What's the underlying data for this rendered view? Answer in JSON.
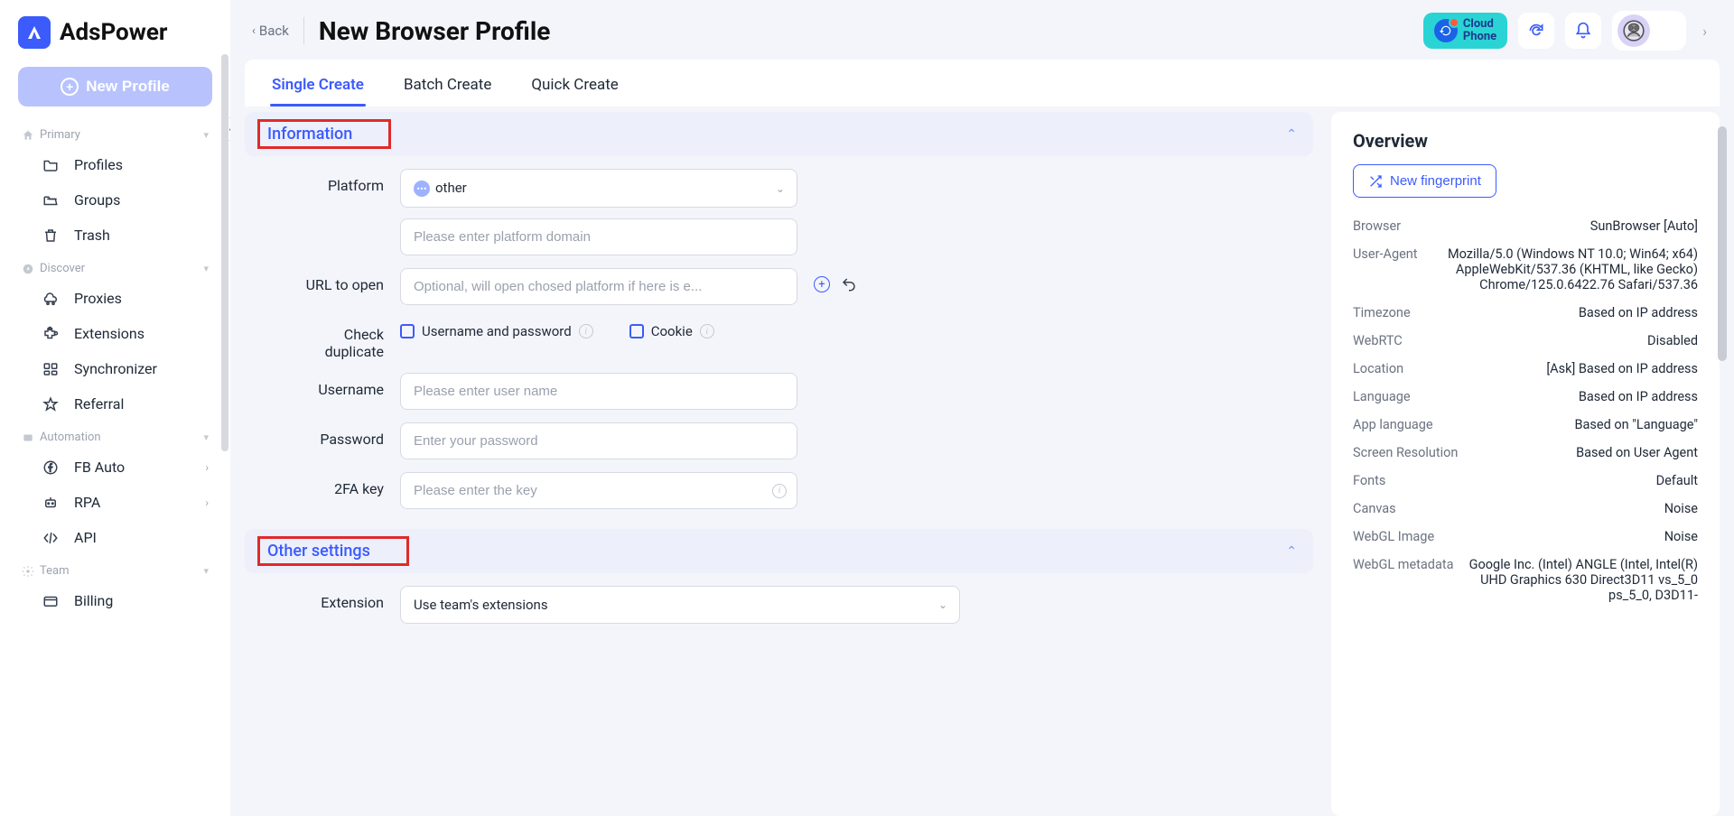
{
  "logo": {
    "text": "AdsPower"
  },
  "new_profile_label": "New Profile",
  "nav": {
    "groups": [
      {
        "title": "Primary",
        "items": [
          {
            "label": "Profiles",
            "icon": "folder"
          },
          {
            "label": "Groups",
            "icon": "folder-open"
          },
          {
            "label": "Trash",
            "icon": "trash"
          }
        ]
      },
      {
        "title": "Discover",
        "items": [
          {
            "label": "Proxies",
            "icon": "proxy"
          },
          {
            "label": "Extensions",
            "icon": "puzzle"
          },
          {
            "label": "Synchronizer",
            "icon": "sync"
          },
          {
            "label": "Referral",
            "icon": "star"
          }
        ]
      },
      {
        "title": "Automation",
        "items": [
          {
            "label": "FB Auto",
            "icon": "fb",
            "chev": true
          },
          {
            "label": "RPA",
            "icon": "robot",
            "chev": true
          },
          {
            "label": "API",
            "icon": "api"
          }
        ]
      },
      {
        "title": "Team",
        "items": [
          {
            "label": "Billing",
            "icon": "card"
          }
        ]
      }
    ]
  },
  "header": {
    "back": "Back",
    "title": "New Browser Profile",
    "cloud_phone": "Cloud\nPhone"
  },
  "tabs": [
    {
      "label": "Single Create",
      "active": true
    },
    {
      "label": "Batch Create",
      "active": false
    },
    {
      "label": "Quick Create",
      "active": false
    }
  ],
  "sections": {
    "information": {
      "title": "Information"
    },
    "other": {
      "title": "Other settings"
    }
  },
  "form": {
    "platform_label": "Platform",
    "platform_value": "other",
    "platform_domain_placeholder": "Please enter platform domain",
    "url_label": "URL to open",
    "url_placeholder": "Optional, will open chosed platform if here is e...",
    "check_dup_label": "Check\nduplicate",
    "check_dup_opts": {
      "userpass": "Username and password",
      "cookie": "Cookie"
    },
    "username_label": "Username",
    "username_placeholder": "Please enter user name",
    "password_label": "Password",
    "password_placeholder": "Enter your password",
    "twofa_label": "2FA key",
    "twofa_placeholder": "Please enter the key",
    "extension_label": "Extension",
    "extension_value": "Use team's extensions"
  },
  "overview": {
    "title": "Overview",
    "new_fp": "New fingerprint",
    "rows": [
      {
        "k": "Browser",
        "v": "SunBrowser [Auto]"
      },
      {
        "k": "User-Agent",
        "v": "Mozilla/5.0 (Windows NT 10.0; Win64; x64) AppleWebKit/537.36 (KHTML, like Gecko) Chrome/125.0.6422.76 Safari/537.36"
      },
      {
        "k": "Timezone",
        "v": "Based on IP address"
      },
      {
        "k": "WebRTC",
        "v": "Disabled"
      },
      {
        "k": "Location",
        "v": "[Ask] Based on IP address"
      },
      {
        "k": "Language",
        "v": "Based on IP address"
      },
      {
        "k": "App language",
        "v": "Based on \"Language\""
      },
      {
        "k": "Screen Resolution",
        "v": "Based on User Agent"
      },
      {
        "k": "Fonts",
        "v": "Default"
      },
      {
        "k": "Canvas",
        "v": "Noise"
      },
      {
        "k": "WebGL Image",
        "v": "Noise"
      },
      {
        "k": "WebGL metadata",
        "v": "Google Inc. (Intel) ANGLE (Intel, Intel(R) UHD Graphics 630 Direct3D11 vs_5_0 ps_5_0, D3D11-"
      }
    ]
  }
}
